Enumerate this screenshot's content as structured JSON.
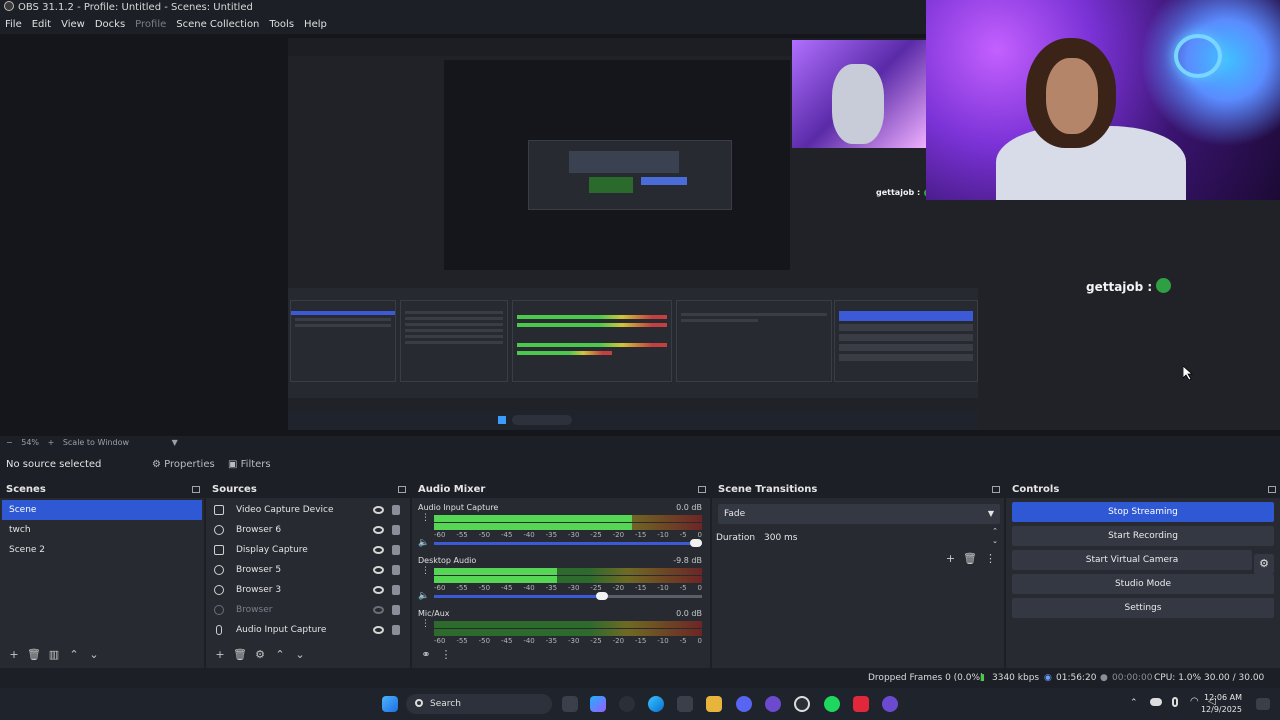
{
  "window": {
    "title": "OBS 31.1.2 - Profile: Untitled - Scenes: Untitled"
  },
  "menu": {
    "items": [
      "File",
      "Edit",
      "View",
      "Docks",
      "Profile",
      "Scene Collection",
      "Tools",
      "Help"
    ]
  },
  "preview": {
    "zoom": "54%",
    "scale_label": "Scale to Window",
    "chat_small": "gettajob :",
    "chat_large": "gettajob :"
  },
  "source_bar": {
    "no_source": "No source selected",
    "properties_label": "Properties",
    "filters_label": "Filters"
  },
  "scenes": {
    "title": "Scenes",
    "items": [
      "Scene",
      "twch",
      "Scene 2"
    ],
    "selected": "Scene"
  },
  "sources": {
    "title": "Sources",
    "items": [
      {
        "name": "Video Capture Device",
        "icon": "camera-icon",
        "visible": true
      },
      {
        "name": "Browser 6",
        "icon": "globe-icon",
        "visible": true
      },
      {
        "name": "Display Capture",
        "icon": "monitor-icon",
        "visible": true
      },
      {
        "name": "Browser 5",
        "icon": "globe-icon",
        "visible": true
      },
      {
        "name": "Browser 3",
        "icon": "globe-icon",
        "visible": true
      },
      {
        "name": "Browser",
        "icon": "globe-icon",
        "visible": false
      },
      {
        "name": "Audio Input Capture",
        "icon": "microphone-icon",
        "visible": true
      }
    ]
  },
  "audio_mixer": {
    "title": "Audio Mixer",
    "ticks": [
      "-60",
      "-55",
      "-50",
      "-45",
      "-40",
      "-35",
      "-30",
      "-25",
      "-20",
      "-15",
      "-10",
      "-5",
      "0"
    ],
    "channels": [
      {
        "name": "Audio Input Capture",
        "db": "0.0 dB",
        "level": 0.74,
        "volume": 1.0
      },
      {
        "name": "Desktop Audio",
        "db": "-9.8 dB",
        "level": 0.46,
        "volume": 0.65
      },
      {
        "name": "Mic/Aux",
        "db": "0.0 dB",
        "level": 0.0,
        "volume": 1.0
      }
    ]
  },
  "transitions": {
    "title": "Scene Transitions",
    "selected": "Fade",
    "duration_label": "Duration",
    "duration_value": "300 ms"
  },
  "controls": {
    "title": "Controls",
    "stop_streaming": "Stop Streaming",
    "start_recording": "Start Recording",
    "start_virtual_camera": "Start Virtual Camera",
    "studio_mode": "Studio Mode",
    "settings": "Settings"
  },
  "status": {
    "dropped_frames": "Dropped Frames 0 (0.0%)",
    "bitrate": "3340 kbps",
    "stream_time": "01:56:20",
    "record_time": "00:00:00",
    "cpu": "CPU: 1.0%",
    "fps": "30.00 / 30.00 FPS"
  },
  "taskbar": {
    "search_label": "Search",
    "time": "12:06 AM",
    "date": "12/9/2025"
  },
  "colors": {
    "accent": "#2f58d4",
    "meter_green": "#55d655",
    "meter_yellow": "#d2c43a",
    "meter_red": "#c24040"
  }
}
